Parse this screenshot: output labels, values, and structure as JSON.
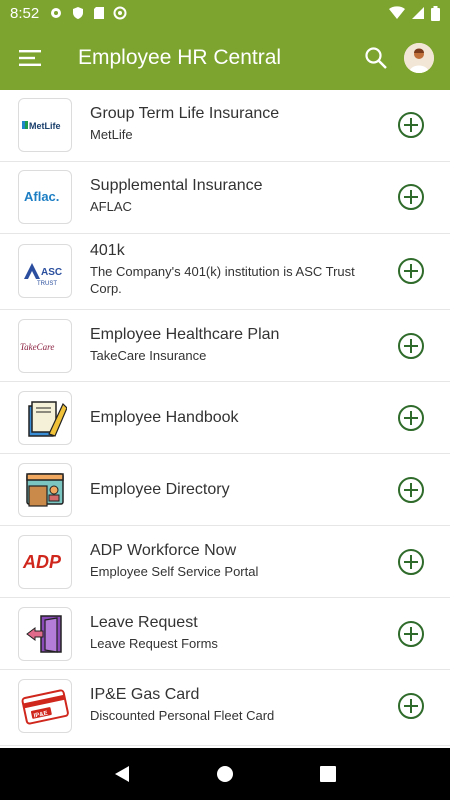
{
  "status_bar": {
    "time": "8:52"
  },
  "app_bar": {
    "title": "Employee HR Central"
  },
  "items": [
    {
      "title": "Group Term Life Insurance",
      "subtitle": "MetLife",
      "logo_text": "MetLife"
    },
    {
      "title": "Supplemental Insurance",
      "subtitle": "AFLAC",
      "logo_text": "Aflac."
    },
    {
      "title": "401k",
      "subtitle": "The Company's 401(k) institution is ASC Trust Corp.",
      "logo_text": "ASC",
      "logo_subtext": "TRUST"
    },
    {
      "title": "Employee Healthcare Plan",
      "subtitle": "TakeCare Insurance",
      "logo_text": "TakeCare"
    },
    {
      "title": "Employee Handbook",
      "subtitle": ""
    },
    {
      "title": "Employee Directory",
      "subtitle": ""
    },
    {
      "title": "ADP Workforce Now",
      "subtitle": "Employee Self Service Portal",
      "logo_text": "ADP"
    },
    {
      "title": "Leave Request",
      "subtitle": "Leave Request Forms"
    },
    {
      "title": "IP&E Gas Card",
      "subtitle": "Discounted Personal Fleet Card",
      "logo_text": "IP&E"
    }
  ],
  "colors": {
    "accent": "#7ca42e",
    "add_icon": "#2f6b2a"
  }
}
